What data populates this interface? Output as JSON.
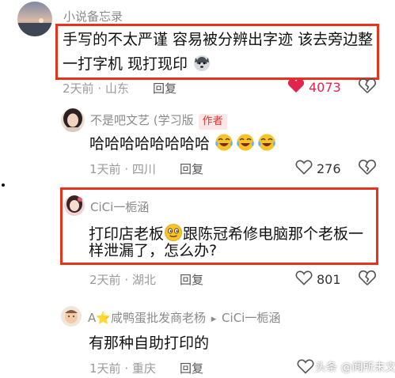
{
  "colors": {
    "highlight": "#e8331c",
    "liked": "#e0244f",
    "author_tag_bg": "#fde6e6",
    "author_tag_text": "#e53935"
  },
  "comments": [
    {
      "username": "小说备忘录",
      "text_line1": "手写的不太严谨 容易被分辨出字迹 该去旁边整",
      "text_line2": "一打字机 现打现印",
      "time": "2天前",
      "location": "山东",
      "reply": "回复",
      "likes": "4073",
      "liked": true
    },
    {
      "username": "不是吧文艺 (学习版",
      "badge": "作者",
      "text": "哈哈哈哈哈哈哈哈",
      "time": "1天前",
      "location": "四川",
      "reply": "回复",
      "likes": "276"
    },
    {
      "username": "CiCi一栀涵",
      "text_line1_a": "打印店老板",
      "text_line1_b": "跟陈冠希修电脑那个老板一",
      "text_line2": "样泄漏了，怎么办?",
      "time": "2天前",
      "location": "湖北",
      "reply": "回复",
      "likes": "801"
    },
    {
      "username": "A⭐咸鸭蛋批发商老杨",
      "reply_arrow": "▸",
      "reply_to": "CiCi一栀涵",
      "text": "有那种自助打印的",
      "time": "1天前",
      "location": "重庆",
      "reply": "回复"
    }
  ],
  "separator": "·",
  "watermark": "头条 @闻所未文"
}
